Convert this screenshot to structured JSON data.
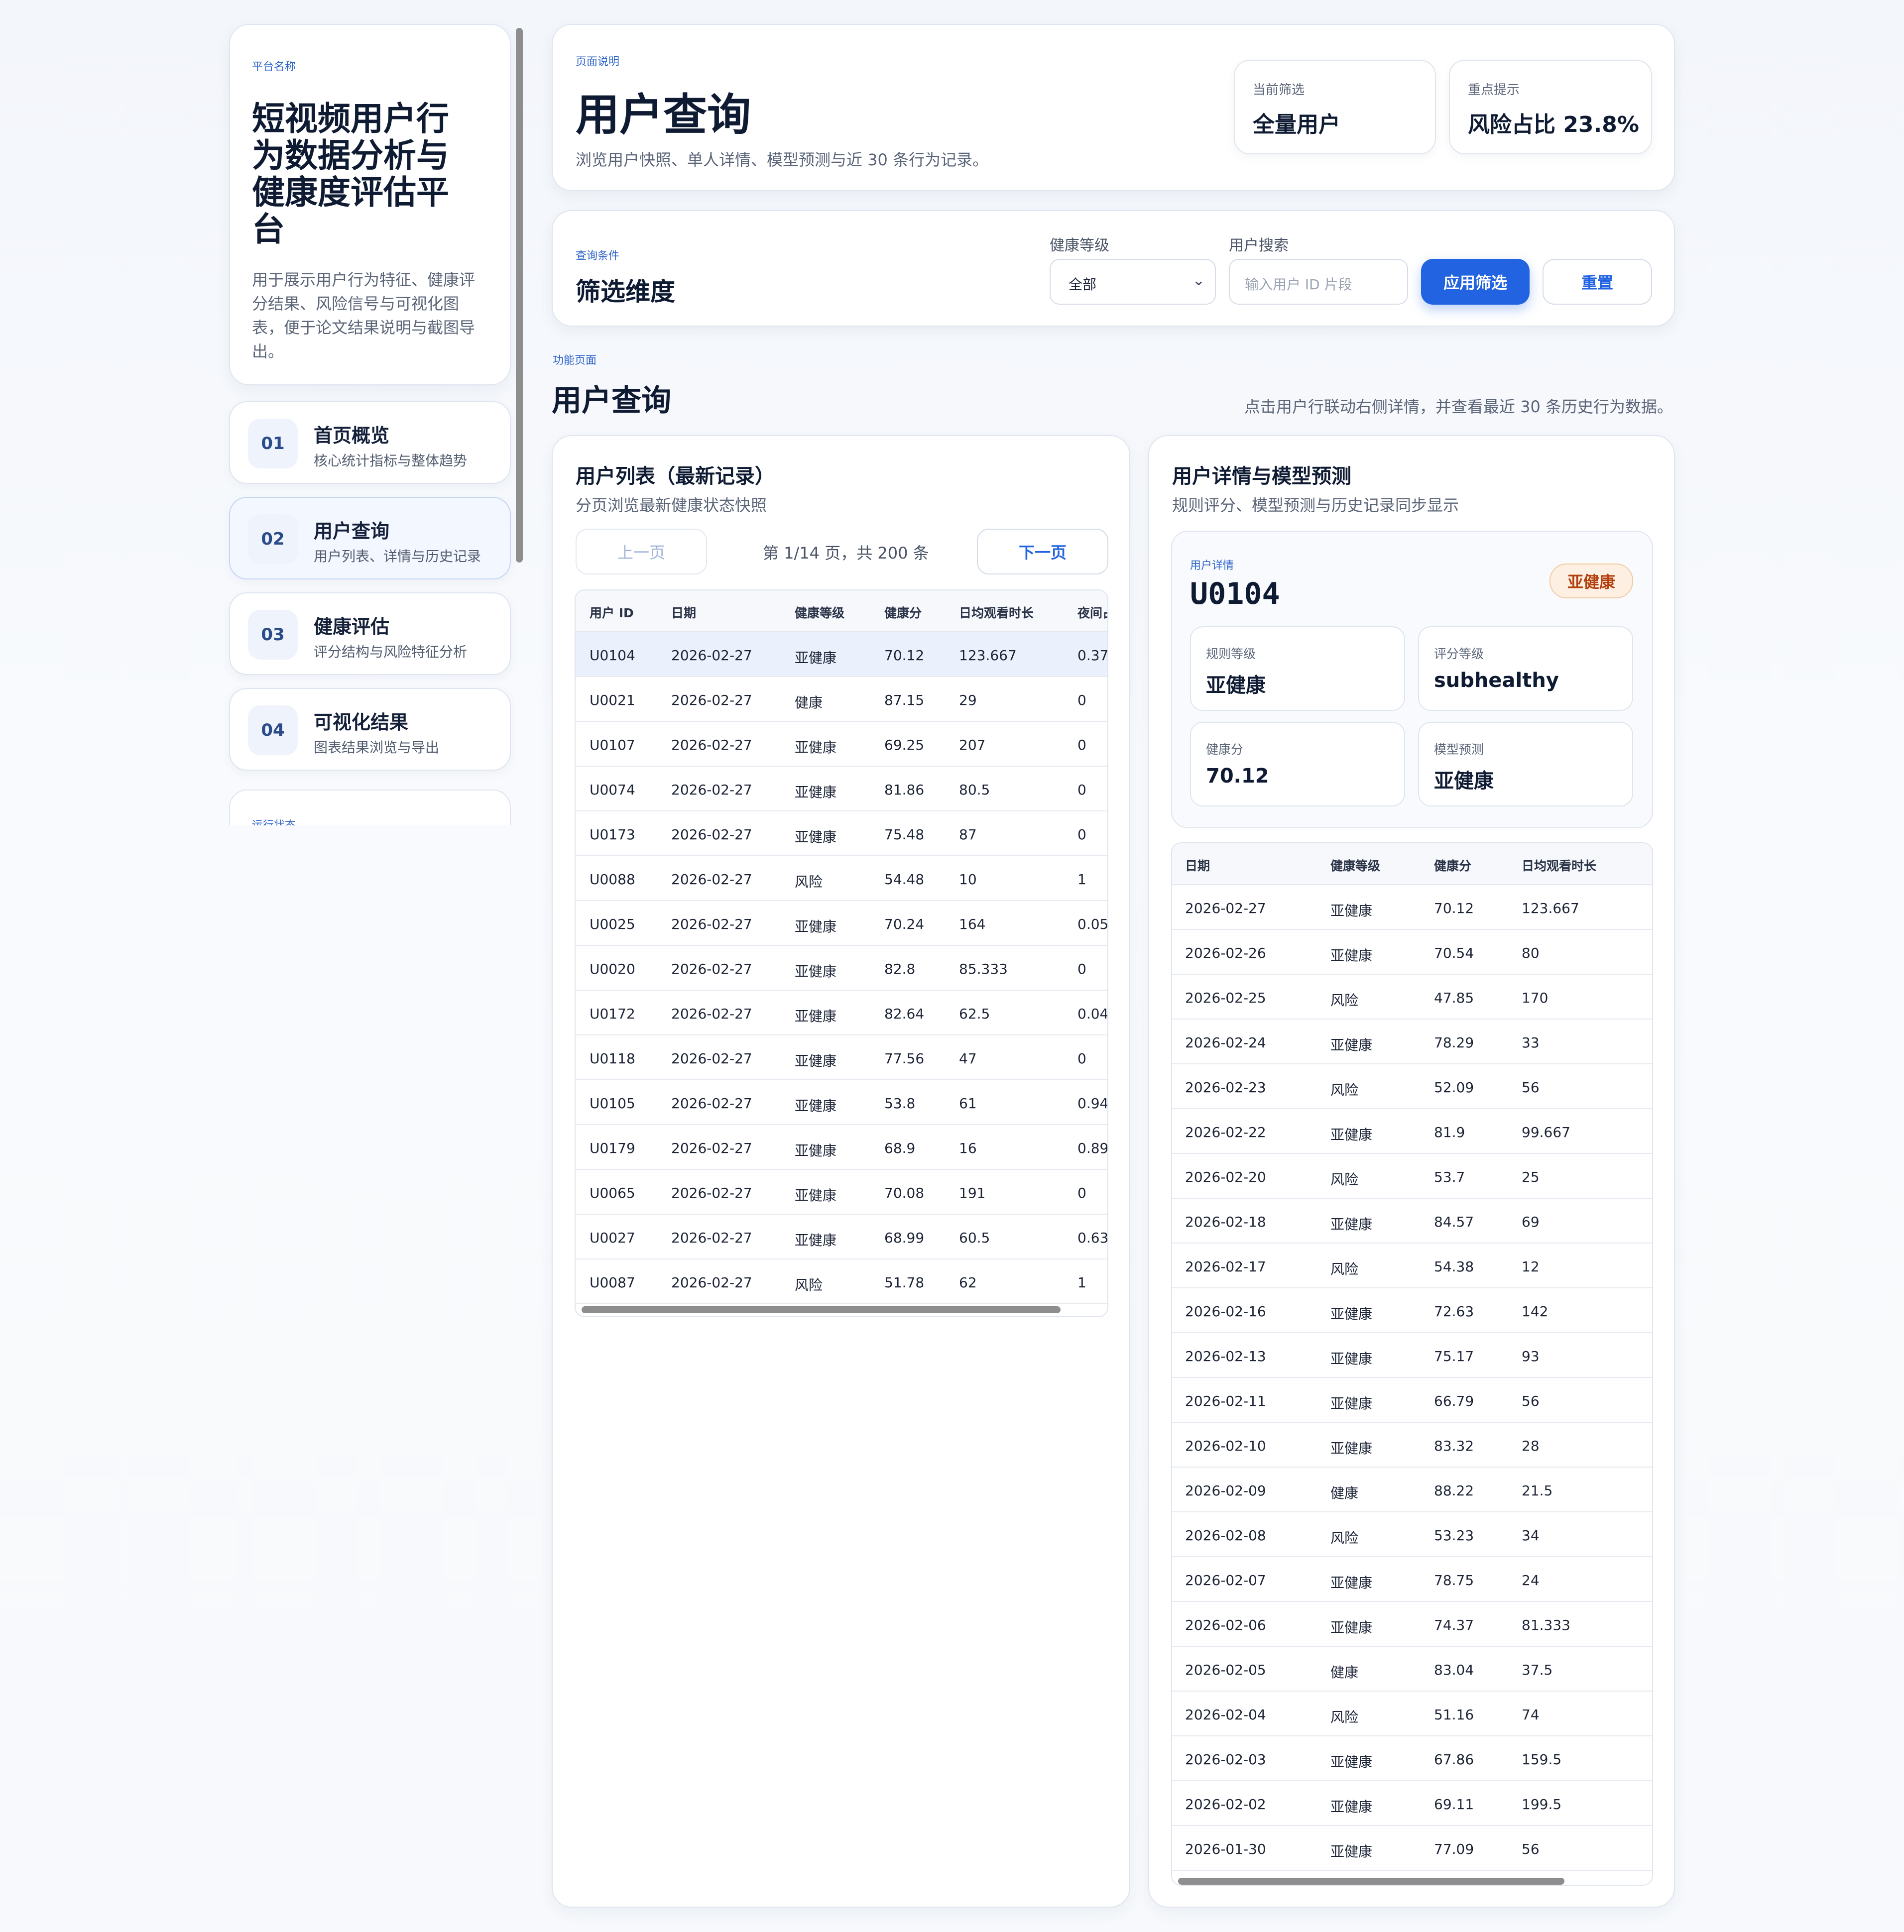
{
  "sidebar": {
    "eyebrow": "平台名称",
    "title": "短视频用户行为数据分析与健康度评估平台",
    "description": "用于展示用户行为特征、健康评分结果、风险信号与可视化图表，便于论文结果说明与截图导出。",
    "nav": [
      {
        "num": "01",
        "label": "首页概览",
        "sub": "核心统计指标与整体趋势"
      },
      {
        "num": "02",
        "label": "用户查询",
        "sub": "用户列表、详情与历史记录"
      },
      {
        "num": "03",
        "label": "健康评估",
        "sub": "评分结构与风险特征分析"
      },
      {
        "num": "04",
        "label": "可视化结果",
        "sub": "图表结果浏览与导出"
      }
    ],
    "status_eyebrow": "运行状态"
  },
  "header": {
    "eyebrow": "页面说明",
    "title": "用户查询",
    "description": "浏览用户快照、单人详情、模型预测与近 30 条行为记录。",
    "kpis": [
      {
        "label": "当前筛选",
        "value": "全量用户"
      },
      {
        "label": "重点提示",
        "value": "风险占比 23.8%"
      }
    ]
  },
  "filter": {
    "eyebrow": "查询条件",
    "title": "筛选维度",
    "level_label": "健康等级",
    "level_value": "全部",
    "search_label": "用户搜索",
    "search_placeholder": "输入用户 ID 片段",
    "apply_label": "应用筛选",
    "reset_label": "重置"
  },
  "section": {
    "eyebrow": "功能页面",
    "title": "用户查询",
    "hint": "点击用户行联动右侧详情，并查看最近 30 条历史行为数据。"
  },
  "user_list": {
    "title": "用户列表（最新记录）",
    "subtitle": "分页浏览最新健康状态快照",
    "prev_label": "上一页",
    "page_info": "第 1/14 页，共 200 条",
    "next_label": "下一页",
    "columns": [
      "用户 ID",
      "日期",
      "健康等级",
      "健康分",
      "日均观看时长",
      "夜间占"
    ],
    "rows": [
      [
        "U0104",
        "2026-02-27",
        "亚健康",
        "70.12",
        "123.667",
        "0.37"
      ],
      [
        "U0021",
        "2026-02-27",
        "健康",
        "87.15",
        "29",
        "0"
      ],
      [
        "U0107",
        "2026-02-27",
        "亚健康",
        "69.25",
        "207",
        "0"
      ],
      [
        "U0074",
        "2026-02-27",
        "亚健康",
        "81.86",
        "80.5",
        "0"
      ],
      [
        "U0173",
        "2026-02-27",
        "亚健康",
        "75.48",
        "87",
        "0"
      ],
      [
        "U0088",
        "2026-02-27",
        "风险",
        "54.48",
        "10",
        "1"
      ],
      [
        "U0025",
        "2026-02-27",
        "亚健康",
        "70.24",
        "164",
        "0.05"
      ],
      [
        "U0020",
        "2026-02-27",
        "亚健康",
        "82.8",
        "85.333",
        "0"
      ],
      [
        "U0172",
        "2026-02-27",
        "亚健康",
        "82.64",
        "62.5",
        "0.04"
      ],
      [
        "U0118",
        "2026-02-27",
        "亚健康",
        "77.56",
        "47",
        "0"
      ],
      [
        "U0105",
        "2026-02-27",
        "亚健康",
        "53.8",
        "61",
        "0.94"
      ],
      [
        "U0179",
        "2026-02-27",
        "亚健康",
        "68.9",
        "16",
        "0.89"
      ],
      [
        "U0065",
        "2026-02-27",
        "亚健康",
        "70.08",
        "191",
        "0"
      ],
      [
        "U0027",
        "2026-02-27",
        "亚健康",
        "68.99",
        "60.5",
        "0.63"
      ],
      [
        "U0087",
        "2026-02-27",
        "风险",
        "51.78",
        "62",
        "1"
      ]
    ]
  },
  "detail": {
    "title": "用户详情与模型预测",
    "subtitle": "规则评分、模型预测与历史记录同步显示",
    "eyebrow": "用户详情",
    "user_id": "U0104",
    "badge": "亚健康",
    "cells": [
      {
        "label": "规则等级",
        "value": "亚健康"
      },
      {
        "label": "评分等级",
        "value": "subhealthy"
      },
      {
        "label": "健康分",
        "value": "70.12"
      },
      {
        "label": "模型预测",
        "value": "亚健康"
      }
    ],
    "history_columns": [
      "日期",
      "健康等级",
      "健康分",
      "日均观看时长"
    ],
    "history": [
      [
        "2026-02-27",
        "亚健康",
        "70.12",
        "123.667"
      ],
      [
        "2026-02-26",
        "亚健康",
        "70.54",
        "80"
      ],
      [
        "2026-02-25",
        "风险",
        "47.85",
        "170"
      ],
      [
        "2026-02-24",
        "亚健康",
        "78.29",
        "33"
      ],
      [
        "2026-02-23",
        "风险",
        "52.09",
        "56"
      ],
      [
        "2026-02-22",
        "亚健康",
        "81.9",
        "99.667"
      ],
      [
        "2026-02-20",
        "风险",
        "53.7",
        "25"
      ],
      [
        "2026-02-18",
        "亚健康",
        "84.57",
        "69"
      ],
      [
        "2026-02-17",
        "风险",
        "54.38",
        "12"
      ],
      [
        "2026-02-16",
        "亚健康",
        "72.63",
        "142"
      ],
      [
        "2026-02-13",
        "亚健康",
        "75.17",
        "93"
      ],
      [
        "2026-02-11",
        "亚健康",
        "66.79",
        "56"
      ],
      [
        "2026-02-10",
        "亚健康",
        "83.32",
        "28"
      ],
      [
        "2026-02-09",
        "健康",
        "88.22",
        "21.5"
      ],
      [
        "2026-02-08",
        "风险",
        "53.23",
        "34"
      ],
      [
        "2026-02-07",
        "亚健康",
        "78.75",
        "24"
      ],
      [
        "2026-02-06",
        "亚健康",
        "74.37",
        "81.333"
      ],
      [
        "2026-02-05",
        "健康",
        "83.04",
        "37.5"
      ],
      [
        "2026-02-04",
        "风险",
        "51.16",
        "74"
      ],
      [
        "2026-02-03",
        "亚健康",
        "67.86",
        "159.5"
      ],
      [
        "2026-02-02",
        "亚健康",
        "69.11",
        "199.5"
      ],
      [
        "2026-01-30",
        "亚健康",
        "77.09",
        "56"
      ]
    ]
  },
  "colors": {
    "accent": "#2163e0",
    "eyebrow": "#2e64c9",
    "selected_row": "#eaf1fd",
    "badge_bg": "#fdf0e3",
    "badge_text": "#b2400e"
  }
}
